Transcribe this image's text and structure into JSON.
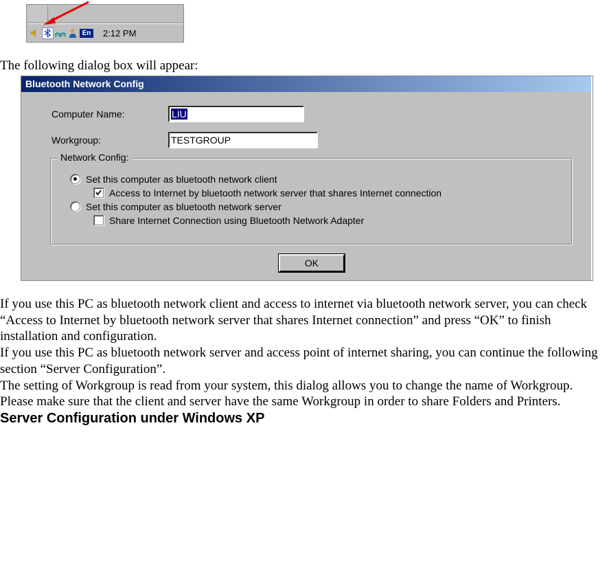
{
  "tray": {
    "time": "2:12 PM",
    "en_label": "En",
    "icons": {
      "speaker": "speaker-icon",
      "bluetooth": "bluetooth-icon",
      "network": "network-icon",
      "user": "user-icon"
    }
  },
  "doc": {
    "intro": "The following dialog box will appear:",
    "para1": "If you use this PC as bluetooth network client and access to internet via bluetooth network server, you can check “Access to Internet by bluetooth network server that shares Internet connection” and  press “OK” to finish installation and configuration.",
    "para2": "If you use this PC as bluetooth network server and access point of internet sharing, you can continue the following section “Server Configuration”.",
    "para3": "The setting of Workgroup is read from your system, this dialog allows you to change the name of Workgroup. Please make sure that the client and server have the same Workgroup in order to share Folders and Printers.",
    "heading": "Server Configuration under Windows XP"
  },
  "dialog": {
    "title": "Bluetooth Network Config",
    "computer_label": "Computer Name:",
    "computer_value": "LIU",
    "workgroup_label": "Workgroup:",
    "workgroup_value": "TESTGROUP",
    "group_legend": "Network Config:",
    "radio_client": "Set this computer as bluetooth network client",
    "radio_client_selected": true,
    "check_access": "Access to Internet by bluetooth network server that shares Internet connection",
    "check_access_checked": true,
    "radio_server": "Set this computer as bluetooth network server",
    "radio_server_selected": false,
    "check_share": "Share Internet Connection using Bluetooth Network Adapter",
    "check_share_checked": false,
    "ok_label": "OK"
  }
}
